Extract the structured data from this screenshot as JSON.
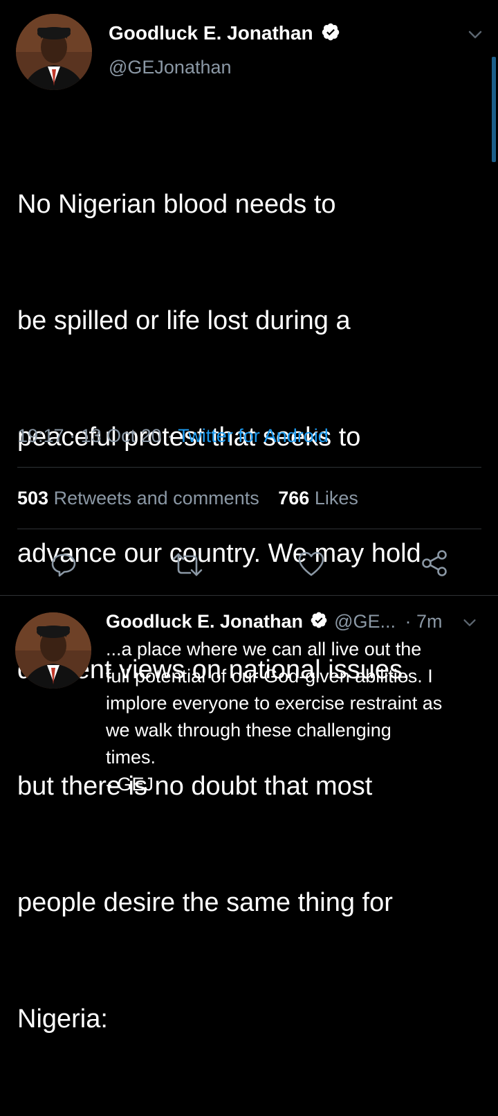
{
  "colors": {
    "background": "#000000",
    "primary_text": "#ffffff",
    "secondary_text": "#8b98a5",
    "link": "#1d9bf0",
    "divider": "#2f3336"
  },
  "main_tweet": {
    "author_name": "Goodluck E. Jonathan",
    "handle": "@GEJonathan",
    "text_lines": [
      "No Nigerian blood needs to",
      "be spilled or life lost during a",
      "peaceful protest that seeks to",
      "advance our country. We may hold",
      "different views on national issues,",
      "but there is no doubt that most",
      "people desire the same thing for",
      "Nigeria:"
    ],
    "time": "19:17",
    "date": "13 Oct 20",
    "source": "Twitter for Android",
    "retweets_count": "503",
    "retweets_label": "Retweets and comments",
    "likes_count": "766",
    "likes_label": "Likes",
    "icons": {
      "menu": "chevron-down-icon",
      "verified": "verified-badge-icon",
      "reply": "reply-icon",
      "retweet": "retweet-icon",
      "like": "like-icon",
      "share": "share-icon"
    }
  },
  "reply_tweet": {
    "author_name": "Goodluck E. Jonathan",
    "handle": "@GE...",
    "time": "7m",
    "text_lines": [
      "...a place where we can all live out the",
      "full potential of our God-given abilities. I",
      "implore everyone to exercise restraint as",
      "we walk through these challenging",
      "times.",
      "- GEJ"
    ]
  }
}
